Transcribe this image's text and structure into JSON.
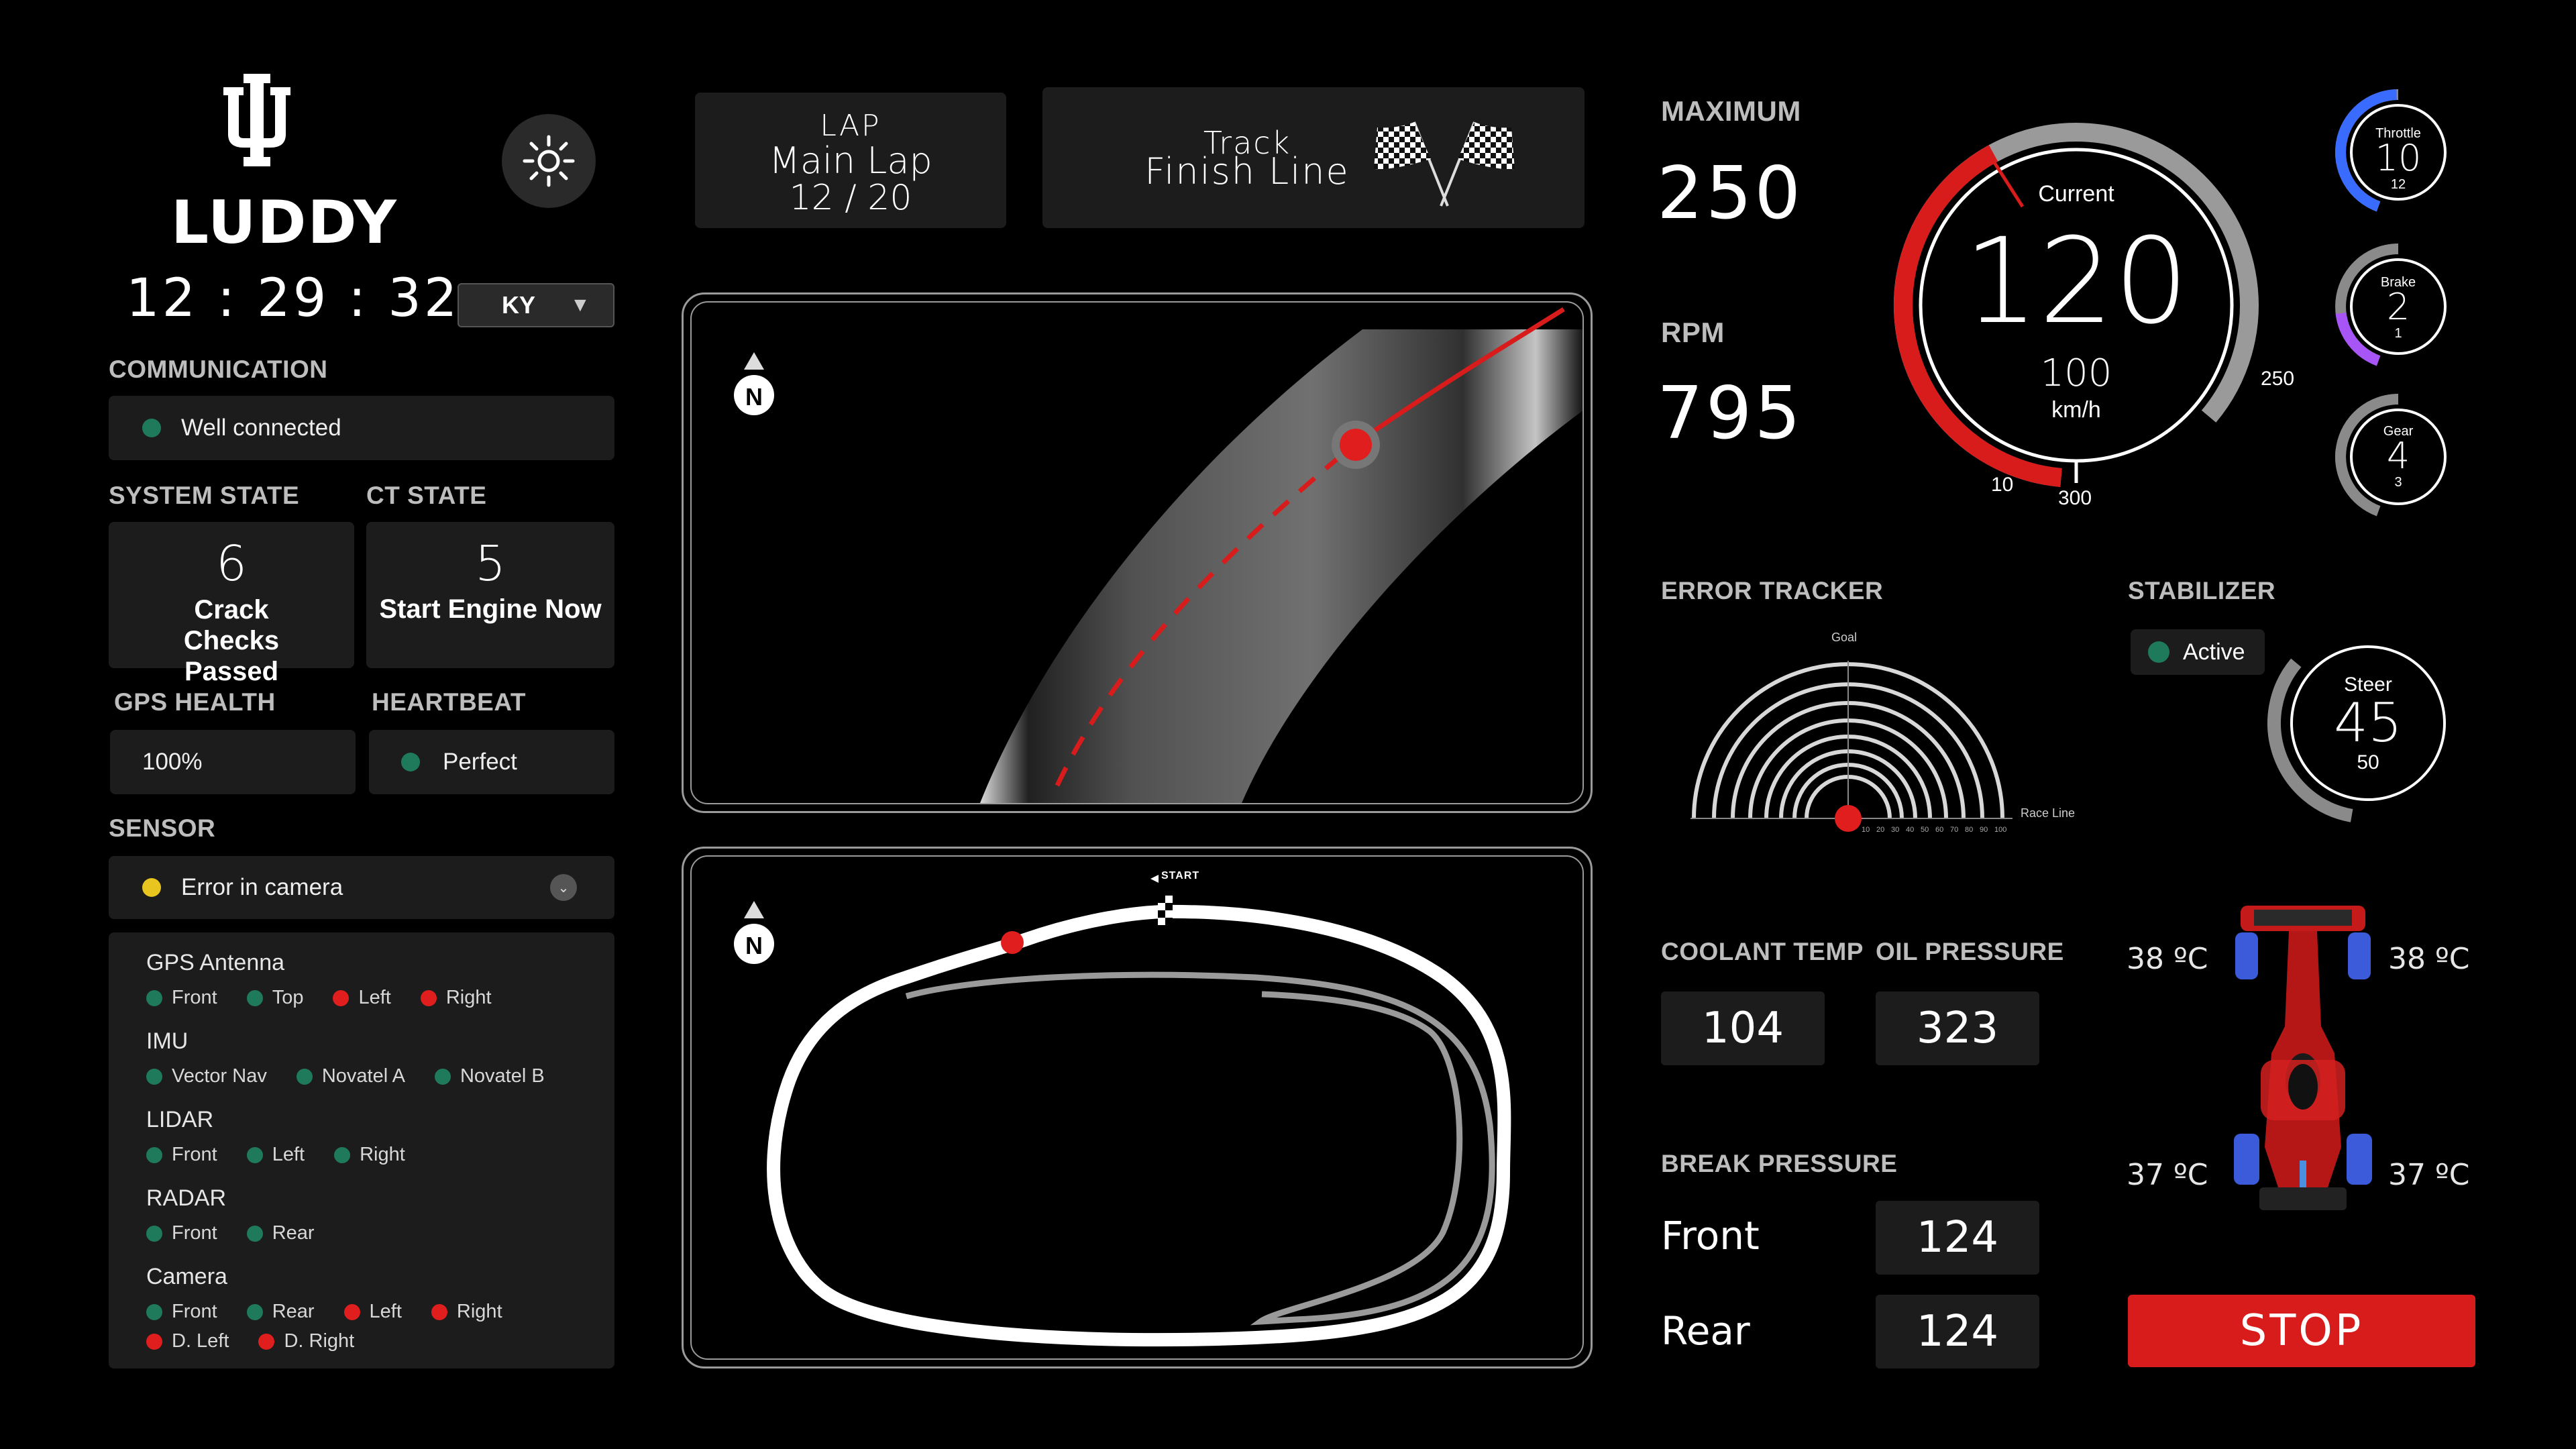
{
  "brand": {
    "name": "LUDDY"
  },
  "clock": "12 : 29 : 32",
  "region_select": {
    "value": "KY"
  },
  "lap": {
    "title": "LAP",
    "name": "Main Lap",
    "progress": "12 / 20"
  },
  "track": {
    "title": "Track",
    "name": "Finish Line"
  },
  "communication": {
    "label": "COMMUNICATION",
    "status": "Well connected"
  },
  "system_state": {
    "label": "SYSTEM STATE",
    "count": "6",
    "text": "Crack Checks Passed"
  },
  "ct_state": {
    "label": "CT STATE",
    "count": "5",
    "text": "Start Engine Now"
  },
  "gps_health": {
    "label": "GPS HEALTH",
    "value": "100%"
  },
  "heartbeat": {
    "label": "HEARTBEAT",
    "value": "Perfect"
  },
  "sensor": {
    "label": "SENSOR",
    "status": "Error in camera",
    "groups": [
      {
        "name": "GPS Antenna",
        "items": [
          {
            "label": "Front",
            "status": "ok"
          },
          {
            "label": "Top",
            "status": "ok"
          },
          {
            "label": "Left",
            "status": "error"
          },
          {
            "label": "Right",
            "status": "error"
          }
        ]
      },
      {
        "name": "IMU",
        "items": [
          {
            "label": "Vector Nav",
            "status": "ok"
          },
          {
            "label": "Novatel A",
            "status": "ok"
          },
          {
            "label": "Novatel B",
            "status": "ok"
          }
        ]
      },
      {
        "name": "LIDAR",
        "items": [
          {
            "label": "Front",
            "status": "ok"
          },
          {
            "label": "Left",
            "status": "ok"
          },
          {
            "label": "Right",
            "status": "ok"
          }
        ]
      },
      {
        "name": "RADAR",
        "items": [
          {
            "label": "Front",
            "status": "ok"
          },
          {
            "label": "Rear",
            "status": "ok"
          }
        ]
      },
      {
        "name": "Camera",
        "items": [
          {
            "label": "Front",
            "status": "ok"
          },
          {
            "label": "Rear",
            "status": "ok"
          },
          {
            "label": "Left",
            "status": "error"
          },
          {
            "label": "Right",
            "status": "error"
          },
          {
            "label": "D. Left",
            "status": "error"
          },
          {
            "label": "D. Right",
            "status": "error"
          }
        ]
      }
    ]
  },
  "maps": {
    "north_label": "N",
    "start_label": "START"
  },
  "maximum": {
    "label": "MAXIMUM",
    "value": "250"
  },
  "rpm": {
    "label": "RPM",
    "value": "795"
  },
  "speedometer": {
    "current_label": "Current",
    "value": "120",
    "sub_value": "100",
    "unit": "km/h",
    "scale_min": "10",
    "scale_max": "250",
    "scale_bottom": "300",
    "fill_fraction": 0.48
  },
  "throttle": {
    "label": "Throttle",
    "value": "10",
    "sub": "12",
    "fill_fraction": 0.45
  },
  "brake": {
    "label": "Brake",
    "value": "2",
    "sub": "1",
    "fill_fraction": 0.18
  },
  "gear": {
    "label": "Gear",
    "value": "4",
    "sub": "3",
    "fill_fraction": 0.22
  },
  "error_tracker": {
    "label": "ERROR TRACKER",
    "goal_label": "Goal",
    "race_line_label": "Race Line",
    "ticks": [
      "10",
      "20",
      "30",
      "40",
      "50",
      "60",
      "70",
      "80",
      "90",
      "100"
    ]
  },
  "stabilizer": {
    "label": "STABILIZER",
    "status": "Active",
    "steer_label": "Steer",
    "value": "45",
    "sub": "50",
    "fill_fraction": 0.3
  },
  "coolant_temp": {
    "label": "COOLANT TEMP",
    "value": "104"
  },
  "oil_pressure": {
    "label": "OIL PRESSURE",
    "value": "323"
  },
  "break_pressure": {
    "label": "BREAK PRESSURE",
    "front_label": "Front",
    "front_value": "124",
    "rear_label": "Rear",
    "rear_value": "124"
  },
  "tire_temps": {
    "front_left": "38 ºC",
    "front_right": "38 ºC",
    "rear_left": "37 ºC",
    "rear_right": "37 ºC"
  },
  "stop_button": {
    "label": "STOP",
    "color": "#d81b1b"
  },
  "colors": {
    "ok": "#1f7a5c",
    "error": "#e01e1e",
    "warning": "#e8c61f",
    "accent": "#d81b1b",
    "throttle": "#3a6bff",
    "brake": "#a855f7"
  }
}
